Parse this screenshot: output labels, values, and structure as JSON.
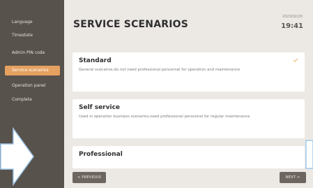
{
  "sidebar": {
    "items": [
      {
        "label": "Language",
        "active": false
      },
      {
        "label": "Timestate",
        "active": false
      },
      {
        "label": "Admin PIN code",
        "active": false
      },
      {
        "label": "Service scenarios",
        "active": true
      },
      {
        "label": "Operation panel",
        "active": false
      },
      {
        "label": "Complete",
        "active": false
      }
    ]
  },
  "header": {
    "title": "SERVICE SCENARIOS",
    "date": "2023/02/20",
    "time": "19:41"
  },
  "scenarios": [
    {
      "name": "Standard",
      "desc": "General scenarios,do not need professional personnel for operation and maintenance",
      "selected": true
    },
    {
      "name": "Self service",
      "desc": "Used in operation business scenarios,need professional personnel for regular maintenance",
      "selected": false
    },
    {
      "name": "Professional",
      "desc": "",
      "selected": false
    }
  ],
  "footer": {
    "prev_label": "< PREVIOUS",
    "next_label": "NEXT >"
  },
  "icons": {
    "check": "check-icon"
  },
  "colors": {
    "sidebar_bg": "#58524c",
    "active_item": "#e5a160",
    "panel_bg": "#ece9e5",
    "check": "#e8b86c",
    "arrow": "#9fc8eb"
  }
}
